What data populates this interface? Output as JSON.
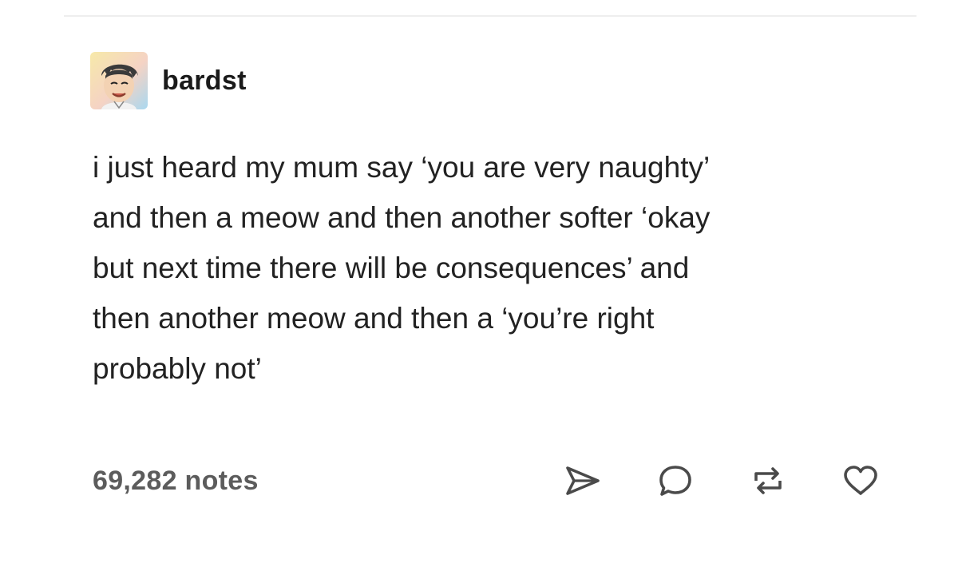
{
  "post": {
    "username": "bardst",
    "avatar_icon": "avatar-illustration",
    "body_lines": [
      "i just heard my mum say ‘you are very naughty’",
      "and then a meow and then another softer ‘okay",
      "but next time there will be consequences’ and",
      "then another meow and then a ‘you’re right",
      "probably not’"
    ],
    "notes_label": "69,282 notes"
  },
  "actions": {
    "share_icon": "share-icon",
    "reply_icon": "reply-icon",
    "reblog_icon": "reblog-icon",
    "like_icon": "heart-icon"
  },
  "colors": {
    "text": "#222222",
    "muted": "#5c5c5c",
    "icon": "#4a4a4a"
  }
}
